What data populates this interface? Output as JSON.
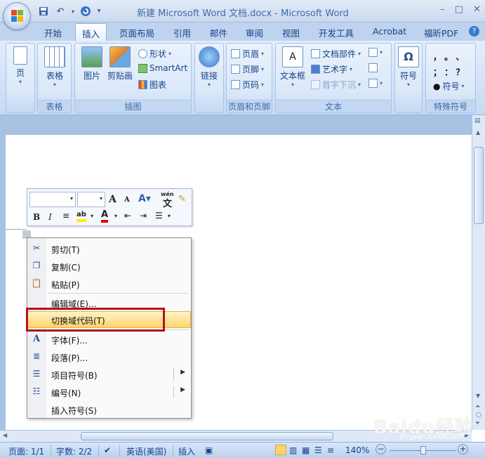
{
  "window": {
    "title": "新建 Microsoft Word 文档.docx - Microsoft Word",
    "controls": [
      "–",
      "□",
      "✕"
    ]
  },
  "tabs": [
    {
      "label": "开始"
    },
    {
      "label": "插入",
      "active": true
    },
    {
      "label": "页面布局"
    },
    {
      "label": "引用"
    },
    {
      "label": "邮件"
    },
    {
      "label": "审阅"
    },
    {
      "label": "视图"
    },
    {
      "label": "开发工具"
    },
    {
      "label": "Acrobat"
    },
    {
      "label": "福昕PDF"
    }
  ],
  "ribbon": {
    "pages": {
      "button": "页"
    },
    "tables": {
      "button": "表格",
      "group": "表格"
    },
    "illustrations": {
      "picture": "图片",
      "clipart": "剪贴画",
      "shapes": "形状",
      "smartart": "SmartArt",
      "chart": "图表",
      "group": "插图"
    },
    "links": {
      "button": "链接"
    },
    "header_footer": {
      "header": "页眉",
      "footer": "页脚",
      "page_number": "页码",
      "group": "页眉和页脚"
    },
    "text": {
      "textbox": "文本框",
      "quickparts": "文档部件",
      "wordart": "艺术字",
      "dropcap": "首字下沉",
      "group": "文本"
    },
    "symbols": {
      "button": "符号"
    },
    "special": {
      "row1": "，  。  、",
      "row2": "；  ：  ？",
      "numbering": "符号",
      "group": "特殊符号"
    }
  },
  "mini_toolbar": {
    "grow_font": "A",
    "shrink_font": "A",
    "bold": "B",
    "italic": "I",
    "phonetic": "wén"
  },
  "context_menu": {
    "items": [
      {
        "label": "剪切(T)",
        "icon": "scissors-icon"
      },
      {
        "label": "复制(C)",
        "icon": "copy-icon"
      },
      {
        "label": "粘贴(P)",
        "icon": "paste-icon"
      },
      {
        "label": "编辑域(E)...",
        "icon": ""
      },
      {
        "label": "切换域代码(T)",
        "icon": "",
        "highlighted": true
      },
      {
        "label": "字体(F)...",
        "icon": "font-icon"
      },
      {
        "label": "段落(P)...",
        "icon": "paragraph-icon"
      },
      {
        "label": "项目符号(B)",
        "icon": "bullets-icon",
        "submenu": true
      },
      {
        "label": "编号(N)",
        "icon": "numbering-icon",
        "submenu": true
      },
      {
        "label": "插入符号(S)",
        "icon": ""
      }
    ]
  },
  "statusbar": {
    "page": "页面: 1/1",
    "words": "字数: 2/2",
    "language": "英语(美国)",
    "mode": "插入",
    "zoom": "140%"
  },
  "watermark": {
    "text": "Baidu经验",
    "sub": "jingyan.baidu.com"
  },
  "colors": {
    "highlight_box": "#b3131a",
    "ribbon": "#c7daf3"
  }
}
